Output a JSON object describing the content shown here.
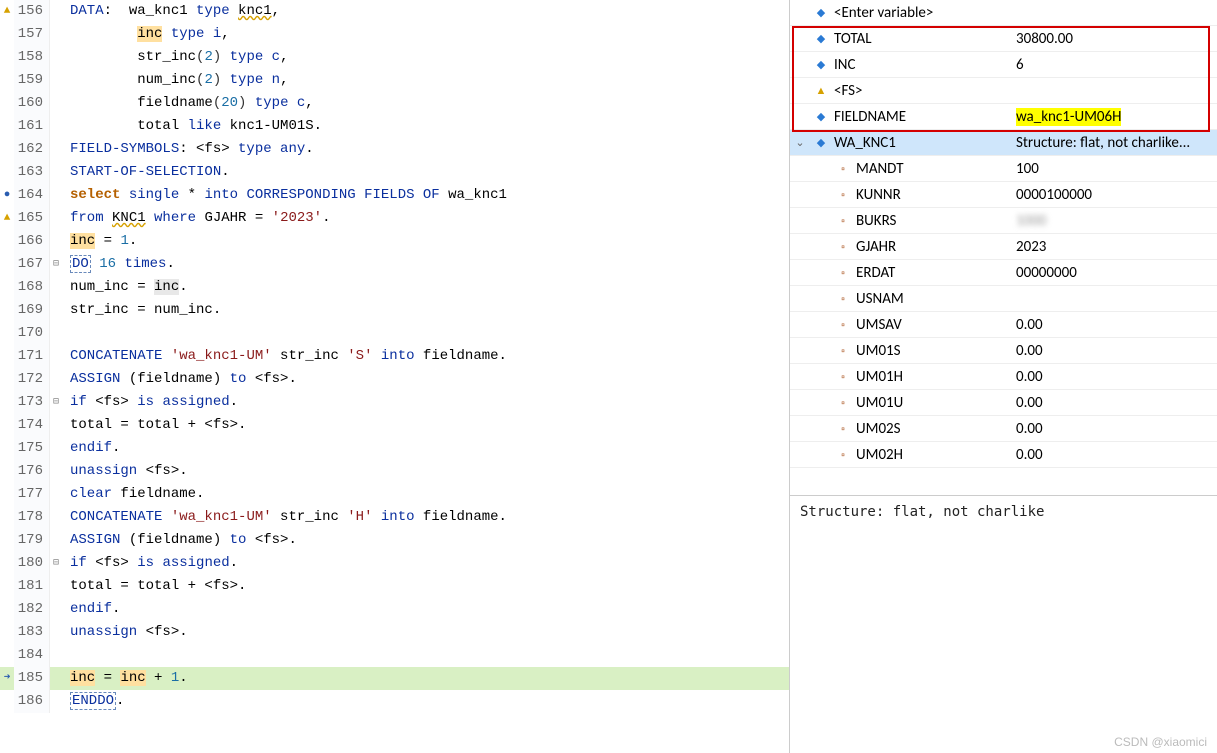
{
  "code": [
    {
      "ln": 156,
      "marker": "warn",
      "segments": [
        {
          "t": "DATA",
          "cls": "k-blue"
        },
        {
          "t": ":  wa_knc1 "
        },
        {
          "t": "type",
          "cls": "k-blue"
        },
        {
          "t": " "
        },
        {
          "t": "knc1",
          "cls": "wave"
        },
        {
          "t": ","
        }
      ]
    },
    {
      "ln": 157,
      "marker": "",
      "segments": [
        {
          "t": "        "
        },
        {
          "t": "inc",
          "cls": "hl-inc"
        },
        {
          "t": " "
        },
        {
          "t": "type",
          "cls": "k-blue"
        },
        {
          "t": " "
        },
        {
          "t": "i",
          "cls": "k-blue"
        },
        {
          "t": ","
        }
      ]
    },
    {
      "ln": 158,
      "marker": "",
      "segments": [
        {
          "t": "        str_inc"
        },
        {
          "t": "(",
          "cls": "punct"
        },
        {
          "t": "2",
          "cls": "num"
        },
        {
          "t": ")",
          "cls": "punct"
        },
        {
          "t": " "
        },
        {
          "t": "type",
          "cls": "k-blue"
        },
        {
          "t": " "
        },
        {
          "t": "c",
          "cls": "k-blue"
        },
        {
          "t": ","
        }
      ]
    },
    {
      "ln": 159,
      "marker": "",
      "segments": [
        {
          "t": "        num_inc"
        },
        {
          "t": "(",
          "cls": "punct"
        },
        {
          "t": "2",
          "cls": "num"
        },
        {
          "t": ")",
          "cls": "punct"
        },
        {
          "t": " "
        },
        {
          "t": "type n",
          "cls": "k-blue"
        },
        {
          "t": ","
        }
      ]
    },
    {
      "ln": 160,
      "marker": "",
      "segments": [
        {
          "t": "        fieldname"
        },
        {
          "t": "(",
          "cls": "punct"
        },
        {
          "t": "20",
          "cls": "num"
        },
        {
          "t": ")",
          "cls": "punct"
        },
        {
          "t": " "
        },
        {
          "t": "type",
          "cls": "k-blue"
        },
        {
          "t": " "
        },
        {
          "t": "c",
          "cls": "k-blue"
        },
        {
          "t": ","
        }
      ]
    },
    {
      "ln": 161,
      "marker": "",
      "segments": [
        {
          "t": "        total "
        },
        {
          "t": "like",
          "cls": "k-blue"
        },
        {
          "t": " knc1-UM01S."
        }
      ]
    },
    {
      "ln": 162,
      "marker": "",
      "segments": [
        {
          "t": "FIELD-SYMBOLS",
          "cls": "k-blue"
        },
        {
          "t": ": <fs> "
        },
        {
          "t": "type any",
          "cls": "k-blue"
        },
        {
          "t": "."
        }
      ]
    },
    {
      "ln": 163,
      "marker": "",
      "segments": [
        {
          "t": "START-OF-SELECTION",
          "cls": "k-blue"
        },
        {
          "t": "."
        }
      ]
    },
    {
      "ln": 164,
      "marker": "bp",
      "segments": [
        {
          "t": "select",
          "cls": "k-orange"
        },
        {
          "t": " "
        },
        {
          "t": "single",
          "cls": "k-blue"
        },
        {
          "t": " * "
        },
        {
          "t": "into CORRESPONDING FIELDS OF",
          "cls": "k-blue"
        },
        {
          "t": " wa_knc1"
        }
      ]
    },
    {
      "ln": 165,
      "marker": "warn",
      "segments": [
        {
          "t": "from",
          "cls": "k-blue"
        },
        {
          "t": " "
        },
        {
          "t": "KNC1",
          "cls": "wave"
        },
        {
          "t": " "
        },
        {
          "t": "where",
          "cls": "k-blue"
        },
        {
          "t": " GJAHR = "
        },
        {
          "t": "'2023'",
          "cls": "str"
        },
        {
          "t": "."
        }
      ]
    },
    {
      "ln": 166,
      "marker": "",
      "segments": [
        {
          "t": "inc",
          "cls": "hl-inc"
        },
        {
          "t": " = "
        },
        {
          "t": "1",
          "cls": "num"
        },
        {
          "t": "."
        }
      ]
    },
    {
      "ln": 167,
      "marker": "",
      "collapse": true,
      "segments": [
        {
          "t": "DO",
          "cls": "k-blue box-dashed"
        },
        {
          "t": " "
        },
        {
          "t": "16",
          "cls": "num"
        },
        {
          "t": " "
        },
        {
          "t": "times",
          "cls": "k-blue"
        },
        {
          "t": "."
        }
      ]
    },
    {
      "ln": 168,
      "marker": "",
      "segments": [
        {
          "t": "num_inc = "
        },
        {
          "t": "inc",
          "cls": "hl-inc-gray"
        },
        {
          "t": "."
        }
      ]
    },
    {
      "ln": 169,
      "marker": "",
      "segments": [
        {
          "t": "str_inc = num_inc."
        }
      ]
    },
    {
      "ln": 170,
      "marker": "",
      "segments": [
        {
          "t": ""
        }
      ]
    },
    {
      "ln": 171,
      "marker": "",
      "segments": [
        {
          "t": "CONCATENATE",
          "cls": "k-blue"
        },
        {
          "t": " "
        },
        {
          "t": "'wa_knc1-UM'",
          "cls": "str"
        },
        {
          "t": " str_inc "
        },
        {
          "t": "'S'",
          "cls": "str"
        },
        {
          "t": " "
        },
        {
          "t": "into",
          "cls": "k-blue"
        },
        {
          "t": " fieldname."
        }
      ]
    },
    {
      "ln": 172,
      "marker": "",
      "segments": [
        {
          "t": "ASSIGN",
          "cls": "k-blue"
        },
        {
          "t": " (fieldname) "
        },
        {
          "t": "to",
          "cls": "k-blue"
        },
        {
          "t": " <fs>."
        }
      ]
    },
    {
      "ln": 173,
      "marker": "",
      "collapse": true,
      "segments": [
        {
          "t": "if",
          "cls": "k-blue"
        },
        {
          "t": " <fs> "
        },
        {
          "t": "is assigned",
          "cls": "k-blue"
        },
        {
          "t": "."
        }
      ]
    },
    {
      "ln": 174,
      "marker": "",
      "segments": [
        {
          "t": "total = total + <fs>."
        }
      ]
    },
    {
      "ln": 175,
      "marker": "",
      "segments": [
        {
          "t": "endif",
          "cls": "k-blue"
        },
        {
          "t": "."
        }
      ]
    },
    {
      "ln": 176,
      "marker": "",
      "segments": [
        {
          "t": "unassign",
          "cls": "k-blue"
        },
        {
          "t": " <fs>."
        }
      ]
    },
    {
      "ln": 177,
      "marker": "",
      "segments": [
        {
          "t": "clear",
          "cls": "k-blue"
        },
        {
          "t": " fieldname."
        }
      ]
    },
    {
      "ln": 178,
      "marker": "",
      "segments": [
        {
          "t": "CONCATENATE",
          "cls": "k-blue"
        },
        {
          "t": " "
        },
        {
          "t": "'wa_knc1-UM'",
          "cls": "str"
        },
        {
          "t": " str_inc "
        },
        {
          "t": "'H'",
          "cls": "str"
        },
        {
          "t": " "
        },
        {
          "t": "into",
          "cls": "k-blue"
        },
        {
          "t": " fieldname."
        }
      ]
    },
    {
      "ln": 179,
      "marker": "",
      "segments": [
        {
          "t": "ASSIGN",
          "cls": "k-blue"
        },
        {
          "t": " (fieldname) "
        },
        {
          "t": "to",
          "cls": "k-blue"
        },
        {
          "t": " <fs>."
        }
      ]
    },
    {
      "ln": 180,
      "marker": "",
      "collapse": true,
      "segments": [
        {
          "t": "if",
          "cls": "k-blue"
        },
        {
          "t": " <fs> "
        },
        {
          "t": "is assigned",
          "cls": "k-blue"
        },
        {
          "t": "."
        }
      ]
    },
    {
      "ln": 181,
      "marker": "",
      "segments": [
        {
          "t": "total = total + <fs>."
        }
      ]
    },
    {
      "ln": 182,
      "marker": "",
      "segments": [
        {
          "t": "endif",
          "cls": "k-blue"
        },
        {
          "t": "."
        }
      ]
    },
    {
      "ln": 183,
      "marker": "",
      "segments": [
        {
          "t": "unassign",
          "cls": "k-blue"
        },
        {
          "t": " <fs>."
        }
      ]
    },
    {
      "ln": 184,
      "marker": "",
      "segments": [
        {
          "t": ""
        }
      ]
    },
    {
      "ln": 185,
      "marker": "cp",
      "current": true,
      "segments": [
        {
          "t": "inc",
          "cls": "hl-inc"
        },
        {
          "t": " = "
        },
        {
          "t": "inc",
          "cls": "hl-inc"
        },
        {
          "t": " + "
        },
        {
          "t": "1",
          "cls": "num"
        },
        {
          "t": "."
        }
      ]
    },
    {
      "ln": 186,
      "marker": "",
      "segments": [
        {
          "t": "ENDDO",
          "cls": "k-blue box-dashed"
        },
        {
          "t": "."
        }
      ]
    }
  ],
  "vars": [
    {
      "icon": "dia-blue",
      "name": "<Enter variable>",
      "value": "",
      "indent": 0,
      "expand": ""
    },
    {
      "icon": "dia-blue",
      "name": "TOTAL",
      "value": "30800.00",
      "indent": 0,
      "expand": ""
    },
    {
      "icon": "dia-blue",
      "name": "INC",
      "value": "6",
      "indent": 0,
      "expand": ""
    },
    {
      "icon": "dia-orange",
      "name": "<FS>",
      "value": "",
      "indent": 0,
      "expand": ""
    },
    {
      "icon": "dia-blue",
      "name": "FIELDNAME",
      "value": "wa_knc1-UM06H",
      "indent": 0,
      "expand": "",
      "hlvalue": true
    },
    {
      "icon": "dia-blue",
      "name": "WA_KNC1",
      "value": "Structure: flat, not charlike...",
      "indent": 0,
      "expand": "v",
      "selected": true
    },
    {
      "icon": "dia-struct",
      "name": "MANDT",
      "value": "100",
      "indent": 1,
      "expand": ""
    },
    {
      "icon": "dia-struct",
      "name": "KUNNR",
      "value": "0000100000",
      "indent": 1,
      "expand": ""
    },
    {
      "icon": "dia-struct",
      "name": "BUKRS",
      "value": "",
      "indent": 1,
      "expand": "",
      "blurval": true
    },
    {
      "icon": "dia-struct",
      "name": "GJAHR",
      "value": "2023",
      "indent": 1,
      "expand": ""
    },
    {
      "icon": "dia-struct",
      "name": "ERDAT",
      "value": "00000000",
      "indent": 1,
      "expand": ""
    },
    {
      "icon": "dia-struct",
      "name": "USNAM",
      "value": "",
      "indent": 1,
      "expand": ""
    },
    {
      "icon": "dia-struct",
      "name": "UMSAV",
      "value": "0.00",
      "indent": 1,
      "expand": ""
    },
    {
      "icon": "dia-struct",
      "name": "UM01S",
      "value": "0.00",
      "indent": 1,
      "expand": ""
    },
    {
      "icon": "dia-struct",
      "name": "UM01H",
      "value": "0.00",
      "indent": 1,
      "expand": ""
    },
    {
      "icon": "dia-struct",
      "name": "UM01U",
      "value": "0.00",
      "indent": 1,
      "expand": ""
    },
    {
      "icon": "dia-struct",
      "name": "UM02S",
      "value": "0.00",
      "indent": 1,
      "expand": ""
    },
    {
      "icon": "dia-struct",
      "name": "UM02H",
      "value": "0.00",
      "indent": 1,
      "expand": ""
    }
  ],
  "detail": "Structure: flat, not charlike",
  "watermark": "CSDN @xiaomici",
  "markerGlyphs": {
    "warn": "▲",
    "bp": "●",
    "cp": "➜",
    "": ""
  },
  "iconGlyphs": {
    "dia-blue": "◆",
    "dia-orange": "▲",
    "dia-struct": "▫"
  }
}
